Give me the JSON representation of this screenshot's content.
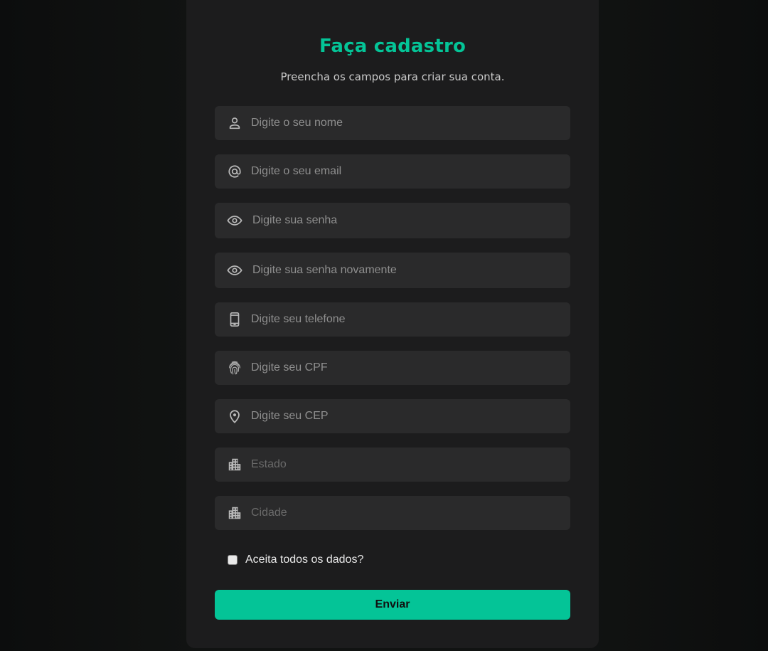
{
  "form": {
    "title": "Faça cadastro",
    "subtitle": "Preencha os campos para criar sua conta.",
    "fields": [
      {
        "icon": "user-icon",
        "placeholder": "Digite o seu nome"
      },
      {
        "icon": "at-sign-icon",
        "placeholder": "Digite o seu email"
      },
      {
        "icon": "eye-icon",
        "placeholder": "Digite sua senha"
      },
      {
        "icon": "eye-icon",
        "placeholder": "Digite sua senha novamente"
      },
      {
        "icon": "smartphone-icon",
        "placeholder": "Digite seu telefone"
      },
      {
        "icon": "fingerprint-icon",
        "placeholder": "Digite seu CPF"
      },
      {
        "icon": "map-pin-icon",
        "placeholder": "Digite seu CEP"
      },
      {
        "icon": "buildings-icon",
        "placeholder": "Estado"
      },
      {
        "icon": "buildings-icon",
        "placeholder": "Cidade"
      }
    ],
    "accept_label": "Aceita todos os dados?",
    "accept_checked": false,
    "submit_label": "Enviar"
  },
  "colors": {
    "accent": "#04c497",
    "card_bg": "#1c1c1d",
    "field_bg": "#2a2a2b",
    "page_bg": "#0f1110",
    "icon": "#b9b9b9",
    "placeholder": "#8f8f8f"
  }
}
